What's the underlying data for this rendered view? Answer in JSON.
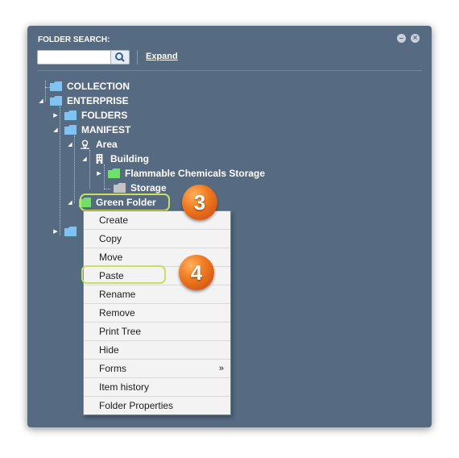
{
  "panel": {
    "title": "FOLDER SEARCH:",
    "search": {
      "value": "",
      "placeholder": ""
    },
    "expand_label": "Expand",
    "minimize_glyph": "–",
    "close_glyph": "×"
  },
  "tree": {
    "nodes": [
      {
        "label": "COLLECTION",
        "icon": "folder-icon",
        "toggle": ""
      },
      {
        "label": "ENTERPRISE",
        "icon": "folder-icon",
        "toggle": "◢"
      },
      {
        "label": "FOLDERS",
        "icon": "folder-icon",
        "toggle": "▶"
      },
      {
        "label": "MANIFEST",
        "icon": "folder-icon",
        "toggle": "◢"
      },
      {
        "label": "Area",
        "icon": "location-pin-icon",
        "toggle": "◢"
      },
      {
        "label": "Building",
        "icon": "building-icon",
        "toggle": "◢"
      },
      {
        "label": "Flammable Chemicals Storage",
        "icon": "green-folder-icon",
        "toggle": "▶"
      },
      {
        "label": "Storage",
        "icon": "gray-folder-icon",
        "toggle": ""
      },
      {
        "label": "Green Folder",
        "icon": "green-folder-icon",
        "toggle": "◢"
      },
      {
        "label": "",
        "icon": "folder-icon",
        "toggle": "▶"
      }
    ]
  },
  "context_menu": {
    "items": [
      {
        "label": "Create"
      },
      {
        "label": "Copy"
      },
      {
        "label": "Move"
      },
      {
        "label": "Paste"
      },
      {
        "label": "Rename"
      },
      {
        "label": "Remove"
      },
      {
        "label": "Print Tree"
      },
      {
        "label": "Hide"
      },
      {
        "label": "Forms",
        "submenu_glyph": "»"
      },
      {
        "label": "Item history"
      },
      {
        "label": "Folder Properties"
      }
    ]
  },
  "callouts": {
    "step_3": "3",
    "step_4": "4"
  },
  "colors": {
    "panel_bg": "#566b82",
    "folder_blue": "#7ec3f1",
    "folder_green": "#6fe06a",
    "folder_gray": "#c4c4c4",
    "highlight": "#c8e05e",
    "callout_orange": "#f07b21"
  }
}
